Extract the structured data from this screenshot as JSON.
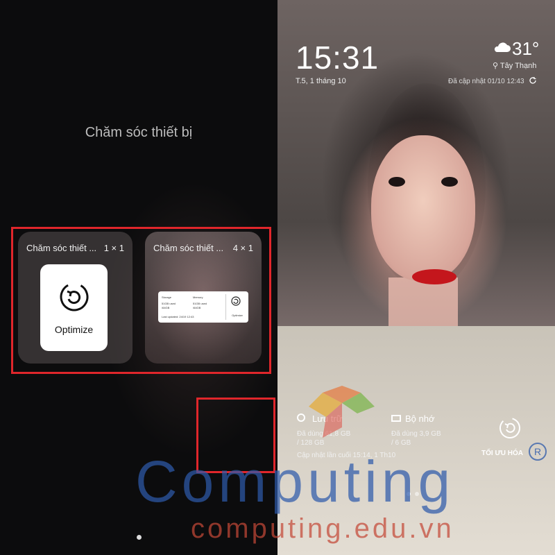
{
  "left_panel": {
    "title": "Chăm sóc thiết bị",
    "widgets": [
      {
        "name": "Chăm sóc thiết ...",
        "size": "1 × 1",
        "button_label": "Optimize"
      },
      {
        "name": "Chăm sóc thiết ...",
        "size": "4 × 1",
        "preview": {
          "storage_label": "Storage",
          "storage_used": "51GB used",
          "storage_total": "/64GB",
          "memory_label": "Memory",
          "memory_used": "51GB used",
          "memory_total": "/64GB",
          "last_updated": "Last updated: 24/19 12:43",
          "optimize_label": "Optimize"
        }
      }
    ]
  },
  "lock_screen": {
    "time": "15:31",
    "date": "T.5, 1 tháng 10",
    "temperature": "31°",
    "location": "Tây Thạnh",
    "weather_updated": "Đã cập nhật 01/10 12:43",
    "storage": {
      "label": "Lưu trữ",
      "used": "Đã dùng 61,8 GB",
      "total": "/ 128 GB"
    },
    "memory": {
      "label": "Bộ nhớ",
      "used": "Đã dùng 3,9 GB",
      "total": "/ 6 GB"
    },
    "last_updated": "Cập nhật lần cuối 15:14, 1 Th10",
    "optimize_label": "TỐI ƯU HÓA"
  },
  "watermark": {
    "brand": "Computing",
    "url": "computing.edu.vn",
    "registered": "R",
    "brand_color": "#2e5aaa",
    "url_color": "#c44838"
  },
  "colors": {
    "highlight": "#e0262b"
  }
}
